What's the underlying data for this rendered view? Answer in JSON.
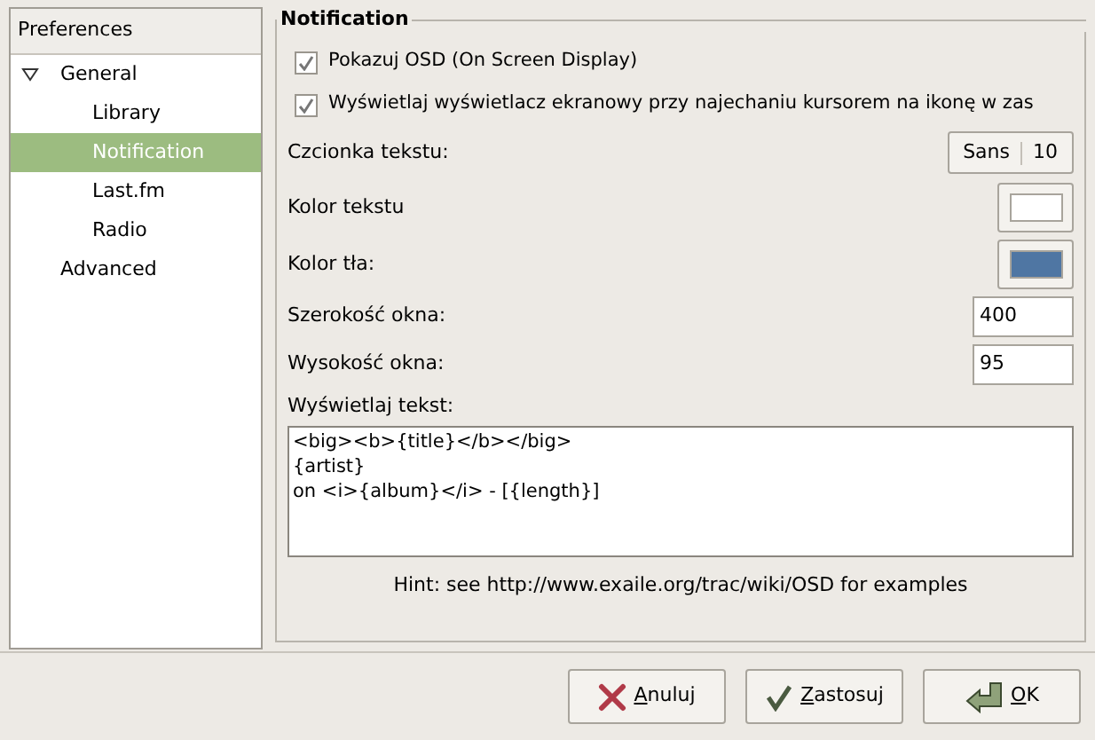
{
  "sidebar": {
    "header": "Preferences",
    "items": [
      {
        "label": "General",
        "expanded": true,
        "selected": false,
        "children": [
          {
            "label": "Library",
            "selected": false
          },
          {
            "label": "Notification",
            "selected": true
          },
          {
            "label": "Last.fm",
            "selected": false
          },
          {
            "label": "Radio",
            "selected": false
          }
        ]
      },
      {
        "label": "Advanced",
        "selected": false
      }
    ]
  },
  "panel": {
    "title": "Notification",
    "checkboxes": [
      {
        "label": "Pokazuj OSD (On Screen Display)",
        "checked": true
      },
      {
        "label": "Wyświetlaj wyświetlacz ekranowy przy najechaniu kursorem na ikonę w zas",
        "checked": true
      }
    ],
    "rows": [
      {
        "kind": "font",
        "label": "Czcionka tekstu:",
        "font": "Sans",
        "size": "10"
      },
      {
        "kind": "color",
        "label": "Kolor tekstu",
        "color": "#ffffff"
      },
      {
        "kind": "color",
        "label": "Kolor tła:",
        "color": "#4f76a3"
      },
      {
        "kind": "number",
        "label": "Szerokość okna:",
        "value": "400"
      },
      {
        "kind": "number",
        "label": "Wysokość okna:",
        "value": "95"
      }
    ],
    "text_label": "Wyświetlaj tekst:",
    "text_lines": [
      "<big><b>{title}</b></big>",
      "{artist}",
      "on <i>{album}</i> - [{length}]"
    ],
    "hint": "Hint: see http://www.exaile.org/trac/wiki/OSD for examples"
  },
  "buttons": [
    {
      "kind": "cancel",
      "label": "Anuluj"
    },
    {
      "kind": "apply",
      "label": "Zastosuj"
    },
    {
      "kind": "ok",
      "label": "OK"
    }
  ]
}
